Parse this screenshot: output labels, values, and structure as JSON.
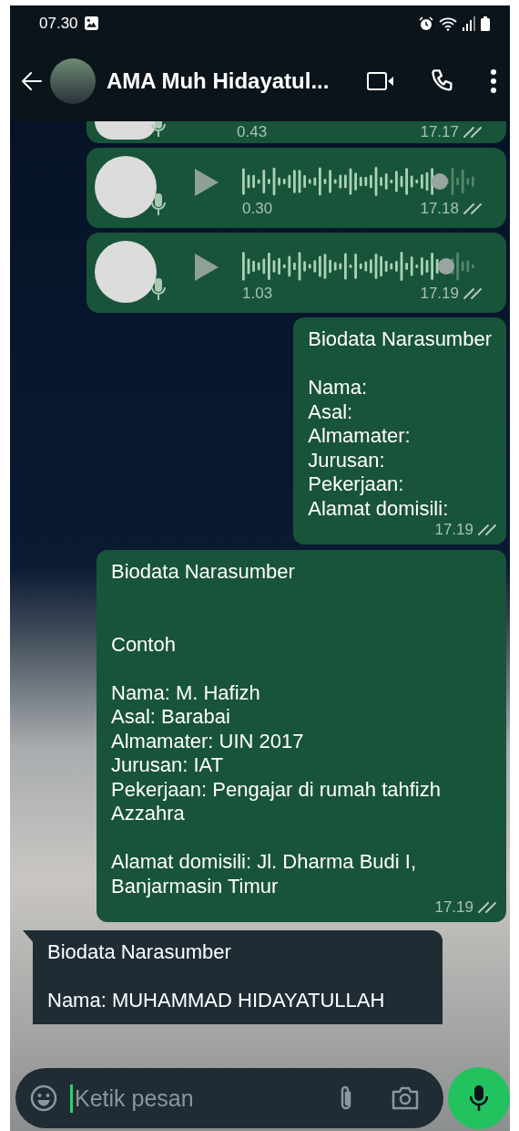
{
  "status_bar": {
    "time": "07.30"
  },
  "header": {
    "contact_name": "AMA Muh Hidayatul..."
  },
  "messages": [
    {
      "kind": "voice",
      "partial": true,
      "duration": "0.43",
      "time": "17.17",
      "read": false
    },
    {
      "kind": "voice",
      "partial": false,
      "duration": "0.30",
      "time": "17.18",
      "read": false,
      "level": 0.84
    },
    {
      "kind": "voice",
      "partial": false,
      "duration": "1.03",
      "time": "17.19",
      "read": false,
      "level": 0.87
    },
    {
      "kind": "outgoing",
      "text": "Biodata Narasumber\n\nNama:\nAsal:\nAlmamater:\nJurusan:\nPekerjaan:\nAlamat domisili:",
      "time": "17.19",
      "read": false
    },
    {
      "kind": "outgoing",
      "text": "Biodata Narasumber\n\n\nContoh\n\nNama: M. Hafizh\nAsal: Barabai\nAlmamater: UIN 2017\nJurusan: IAT\nPekerjaan: Pengajar di rumah tahfizh Azzahra\n\nAlamat domisili: Jl. Dharma Budi I, Banjarmasin Timur",
      "time": "17.19",
      "read": false
    },
    {
      "kind": "incoming",
      "text": "Biodata Narasumber\n\nNama: MUHAMMAD HIDAYATULLAH"
    }
  ],
  "composer": {
    "placeholder": "Ketik pesan"
  }
}
